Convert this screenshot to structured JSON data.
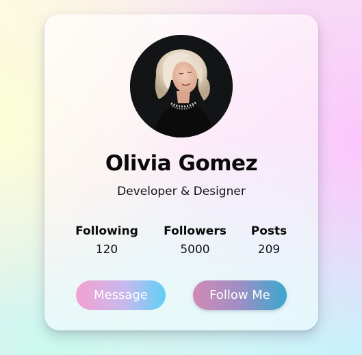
{
  "profile": {
    "name": "Olivia Gomez",
    "title": "Developer & Designer",
    "avatar_alt": "Profile photo"
  },
  "stats": [
    {
      "label": "Following",
      "value": "120"
    },
    {
      "label": "Followers",
      "value": "5000"
    },
    {
      "label": "Posts",
      "value": "209"
    }
  ],
  "actions": {
    "message_label": "Message",
    "follow_label": "Follow Me"
  },
  "colors": {
    "text": "#0a0a0a",
    "message_gradient": [
      "#f3a1d0",
      "#5fd0f6"
    ],
    "follow_gradient": [
      "#d389b6",
      "#3aa8cf"
    ],
    "avatar_bg": "#121416"
  }
}
